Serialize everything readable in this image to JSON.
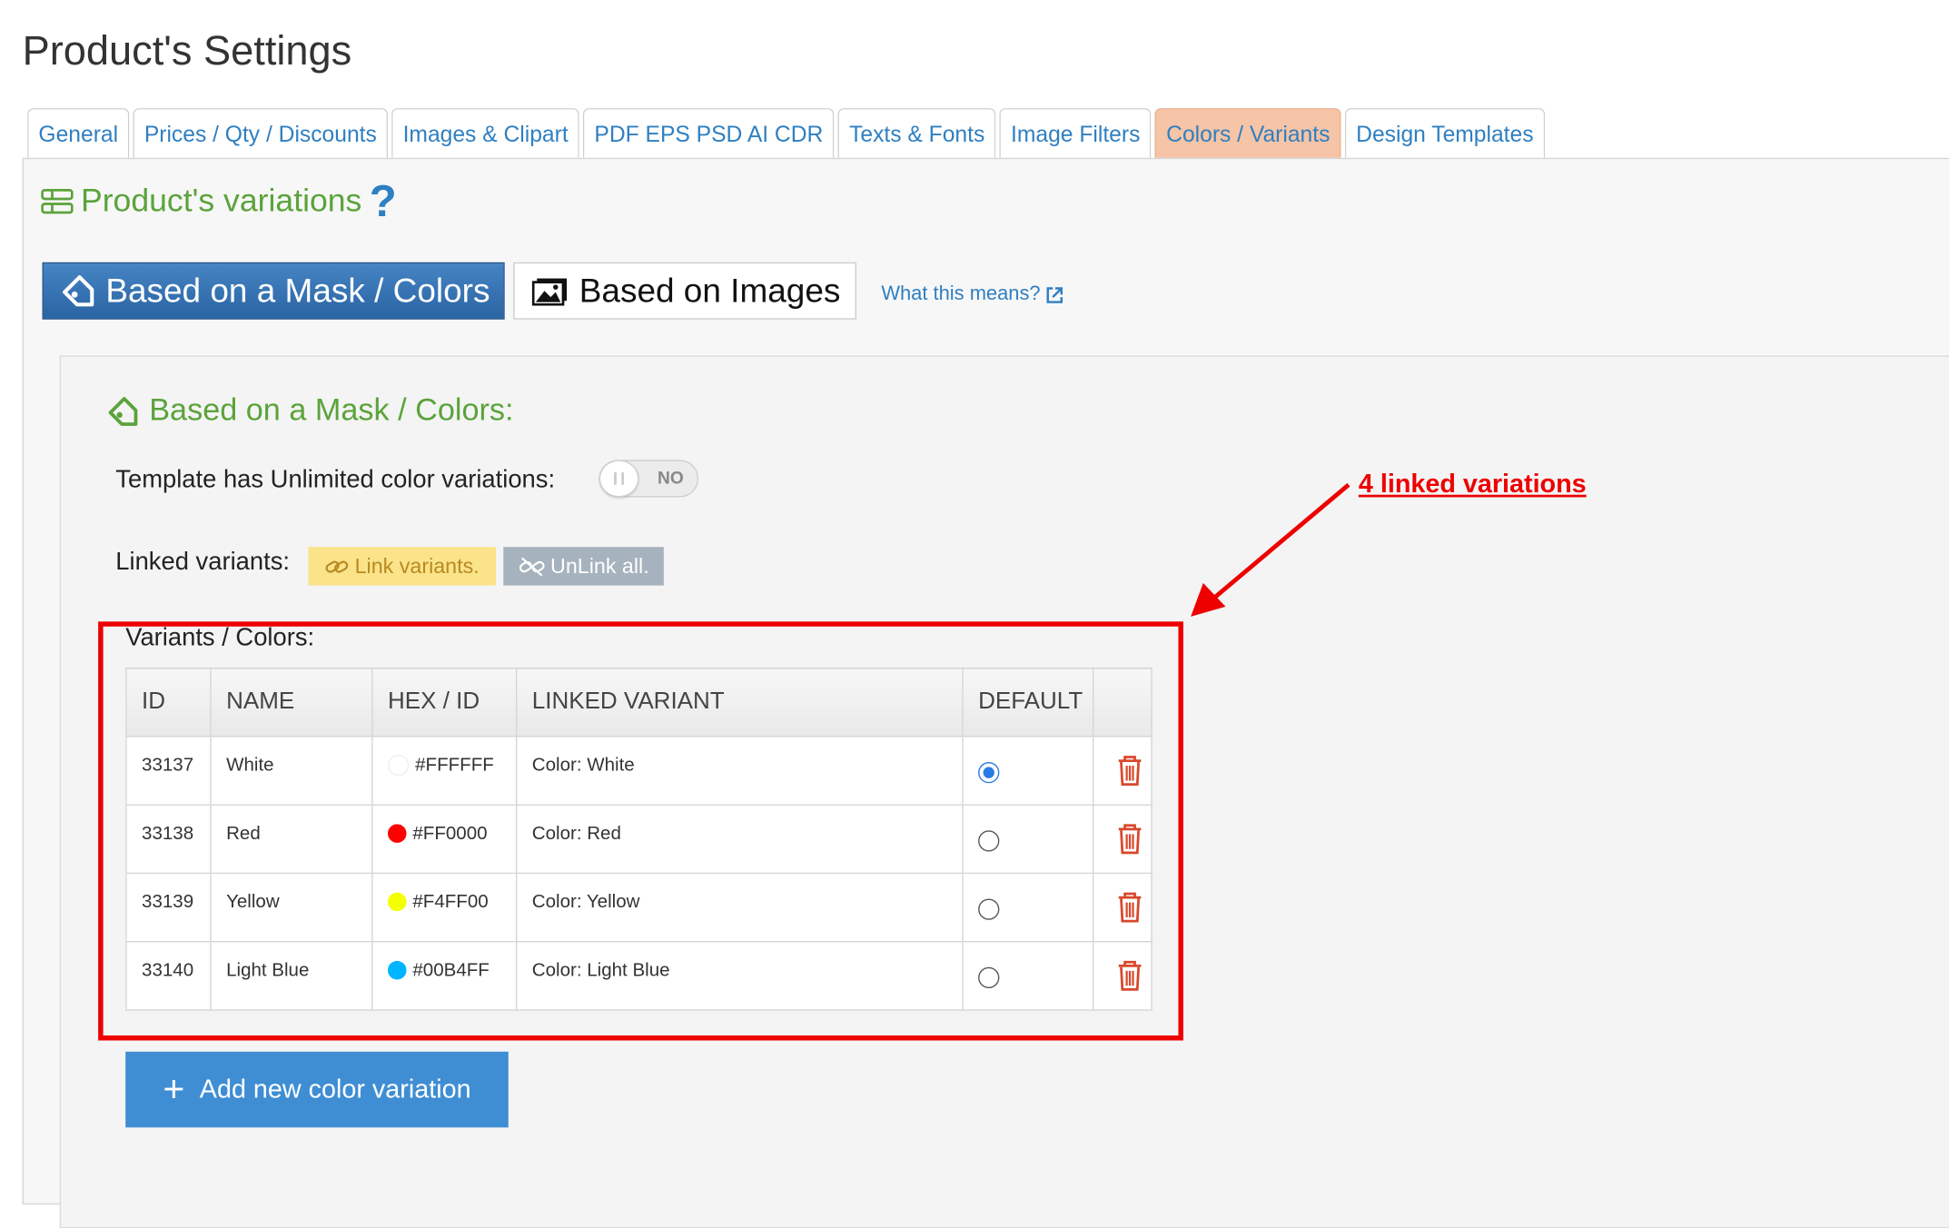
{
  "page_title": "Product's Settings",
  "tabs": [
    {
      "label": "General",
      "active": false
    },
    {
      "label": "Prices / Qty / Discounts",
      "active": false
    },
    {
      "label": "Images & Clipart",
      "active": false
    },
    {
      "label": "PDF EPS PSD AI CDR",
      "active": false
    },
    {
      "label": "Texts & Fonts",
      "active": false
    },
    {
      "label": "Image Filters",
      "active": false
    },
    {
      "label": "Colors / Variants",
      "active": true
    },
    {
      "label": "Design Templates",
      "active": false
    }
  ],
  "section": {
    "title": "Product's variations",
    "help": "?"
  },
  "modes": {
    "mask_label": "Based on a Mask / Colors",
    "images_label": "Based on Images",
    "what_link": "What this means?"
  },
  "mask_panel": {
    "title": "Based on a Mask / Colors:",
    "unlimited_label": "Template has Unlimited color variations:",
    "unlimited_toggle": "NO",
    "linked_label": "Linked variants:",
    "link_button": "Link variants.",
    "unlink_button": "UnLink all.",
    "variants_label": "Variants / Colors:"
  },
  "table": {
    "headers": {
      "id": "ID",
      "name": "NAME",
      "hex": "HEX / ID",
      "linked": "LINKED VARIANT",
      "default": "DEFAULT"
    },
    "rows": [
      {
        "id": "33137",
        "name": "White",
        "hex": "#FFFFFF",
        "linked": "Color: White",
        "default": true,
        "swatch": "#FFFFFF"
      },
      {
        "id": "33138",
        "name": "Red",
        "hex": "#FF0000",
        "linked": "Color: Red",
        "default": false,
        "swatch": "#FF0000"
      },
      {
        "id": "33139",
        "name": "Yellow",
        "hex": "#F4FF00",
        "linked": "Color: Yellow",
        "default": false,
        "swatch": "#F4FF00"
      },
      {
        "id": "33140",
        "name": "Light Blue",
        "hex": "#00B4FF",
        "linked": "Color: Light Blue",
        "default": false,
        "swatch": "#00B4FF"
      }
    ]
  },
  "add_button": "Add new color variation",
  "annotation": "4 linked variations",
  "colors": {
    "accent_blue": "#2f7fc1",
    "green": "#5ba33b",
    "annotation_red": "#ee0000",
    "active_tab": "#f6c4a6"
  },
  "icons": [
    "tag-icon",
    "image-icon",
    "external-link-icon",
    "link-icon",
    "unlink-icon",
    "trash-icon",
    "plus-icon",
    "list-icon"
  ]
}
